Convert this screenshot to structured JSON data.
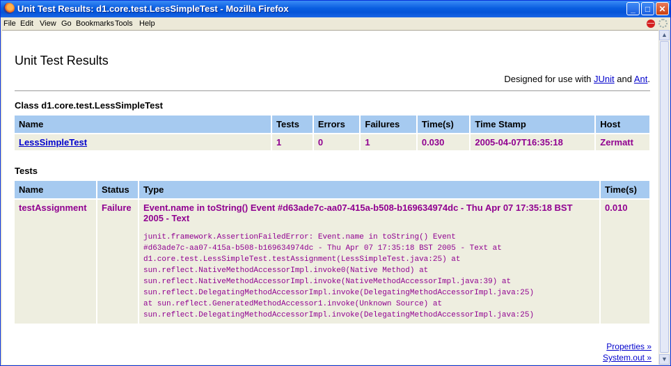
{
  "window": {
    "title": "Unit Test Results: d1.core.test.LessSimpleTest - Mozilla Firefox",
    "min_glyph": "_",
    "max_glyph": "□",
    "close_glyph": "✕"
  },
  "menu": [
    {
      "label": "File"
    },
    {
      "label": "Edit"
    },
    {
      "label": "View"
    },
    {
      "label": "Go"
    },
    {
      "label": "Bookmarks"
    },
    {
      "label": "Tools"
    },
    {
      "label": "Help"
    }
  ],
  "page": {
    "title": "Unit Test Results",
    "designed_prefix": "Designed for use with ",
    "junit_link": "JUnit",
    "and_text": " and ",
    "ant_link": "Ant",
    "period": ".",
    "class_title": "Class d1.core.test.LessSimpleTest",
    "tests_title": "Tests"
  },
  "summary": {
    "headers": [
      "Name",
      "Tests",
      "Errors",
      "Failures",
      "Time(s)",
      "Time Stamp",
      "Host"
    ],
    "row": {
      "name": "LessSimpleTest",
      "tests": "1",
      "errors": "0",
      "failures": "1",
      "time": "0.030",
      "timestamp": "2005-04-07T16:35:18",
      "host": "Zermatt"
    }
  },
  "tests": {
    "headers": [
      "Name",
      "Status",
      "Type",
      "Time(s)"
    ],
    "row": {
      "name": "testAssignment",
      "status": "Failure",
      "message": "Event.name in toString() Event #d63ade7c-aa07-415a-b508-b169634974dc - Thu Apr 07 17:35:18 BST 2005 - Text",
      "trace": "junit.framework.AssertionFailedError: Event.name in toString() Event\n#d63ade7c-aa07-415a-b508-b169634974dc - Thu Apr 07 17:35:18 BST 2005 - Text at\nd1.core.test.LessSimpleTest.testAssignment(LessSimpleTest.java:25) at\nsun.reflect.NativeMethodAccessorImpl.invoke0(Native Method) at\nsun.reflect.NativeMethodAccessorImpl.invoke(NativeMethodAccessorImpl.java:39) at\nsun.reflect.DelegatingMethodAccessorImpl.invoke(DelegatingMethodAccessorImpl.java:25)\nat sun.reflect.GeneratedMethodAccessor1.invoke(Unknown Source) at\nsun.reflect.DelegatingMethodAccessorImpl.invoke(DelegatingMethodAccessorImpl.java:25)",
      "time": "0.010"
    }
  },
  "links": {
    "properties": "Properties »",
    "system_out": "System.out »"
  },
  "icons": {
    "firefox": "firefox-icon",
    "stop": "stop-icon",
    "throbber": "throbber-icon",
    "scroll_up": "scroll-up-arrow-icon",
    "scroll_down": "scroll-down-arrow-icon"
  },
  "colors": {
    "header_bg": "#a6caf0",
    "cell_bg": "#eeeee0",
    "failure_text": "#900090",
    "link": "#0000cc",
    "titlebar": "#0a5ee0"
  }
}
